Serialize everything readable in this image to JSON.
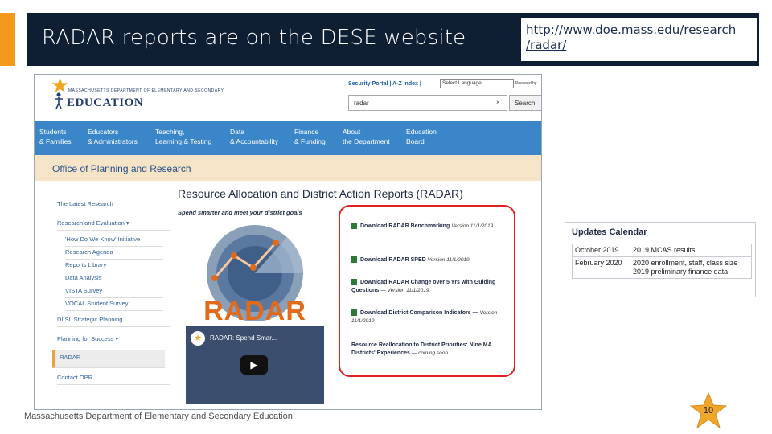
{
  "slide": {
    "title": "RADAR reports are on the DESE website",
    "url": "http://www.doe.mass.edu/research/radar/",
    "url_line1": "http://www.doe.mass.edu/research",
    "url_line2": "/radar/",
    "footer": "Massachusetts Department of Elementary and Secondary Education",
    "page_number": "10",
    "colors": {
      "accent": "#f39a1e",
      "title_bg": "#0f1f33",
      "highlight": "#e02020"
    }
  },
  "site": {
    "logo_small": "MASSACHUSETTS DEPARTMENT OF ELEMENTARY AND SECONDARY",
    "logo_main": "EDUCATION",
    "portal_links": "Security Portal | A-Z Index |",
    "language_select": "Select Language",
    "powered_by": "Powered by",
    "search_value": "radar",
    "search_clear": "×",
    "search_button": "Search",
    "nav": [
      {
        "line1": "Students",
        "line2": "& Families"
      },
      {
        "line1": "Educators",
        "line2": "& Administrators"
      },
      {
        "line1": "Teaching,",
        "line2": "Learning & Testing"
      },
      {
        "line1": "Data",
        "line2": "& Accountability"
      },
      {
        "line1": "Finance",
        "line2": "& Funding"
      },
      {
        "line1": "About",
        "line2": "the Department"
      },
      {
        "line1": "Education",
        "line2": "Board"
      }
    ],
    "office": "Office of Planning and Research",
    "sidebar": [
      "The Latest Research",
      "Research and Evaluation ▾",
      "'How Do We Know' Initiative",
      "Research Agenda",
      "Reports Library",
      "Data Analysis",
      "VISTA Survey",
      "VOCAL Student Survey",
      "DLSL Strategic Planning",
      "Planning for Success ▾",
      "RADAR",
      "Contact OPR"
    ],
    "report_title": "Resource Allocation and District Action Reports (RADAR)",
    "report_subtitle": "Spend smarter and meet your district goals",
    "radar_word": "RADAR",
    "video_title": "RADAR: Spend Smar...",
    "video_more": "⋮",
    "downloads": [
      {
        "text": "Download RADAR Benchmarking",
        "version": "Version 11/1/2019"
      },
      {
        "text": "Download RADAR SPED",
        "version": "Version 11/1/2019"
      },
      {
        "text": "Download RADAR Change over 5 Yrs with Guiding Questions",
        "version": "— Version 11/1/2019"
      },
      {
        "text": "Download District Comparison Indicators —",
        "version": "Version 11/1/2019"
      },
      {
        "text": "Resource Reallocation to District Priorities: Nine MA Districts' Experiences",
        "version": "— coming soon"
      }
    ]
  },
  "calendar": {
    "title": "Updates Calendar",
    "rows": [
      {
        "date": "October 2019",
        "items": [
          "2019 MCAS results"
        ]
      },
      {
        "date": "February 2020",
        "items": [
          "2020 enrollment, staff, class size",
          "2019 preliminary finance data"
        ]
      }
    ]
  }
}
